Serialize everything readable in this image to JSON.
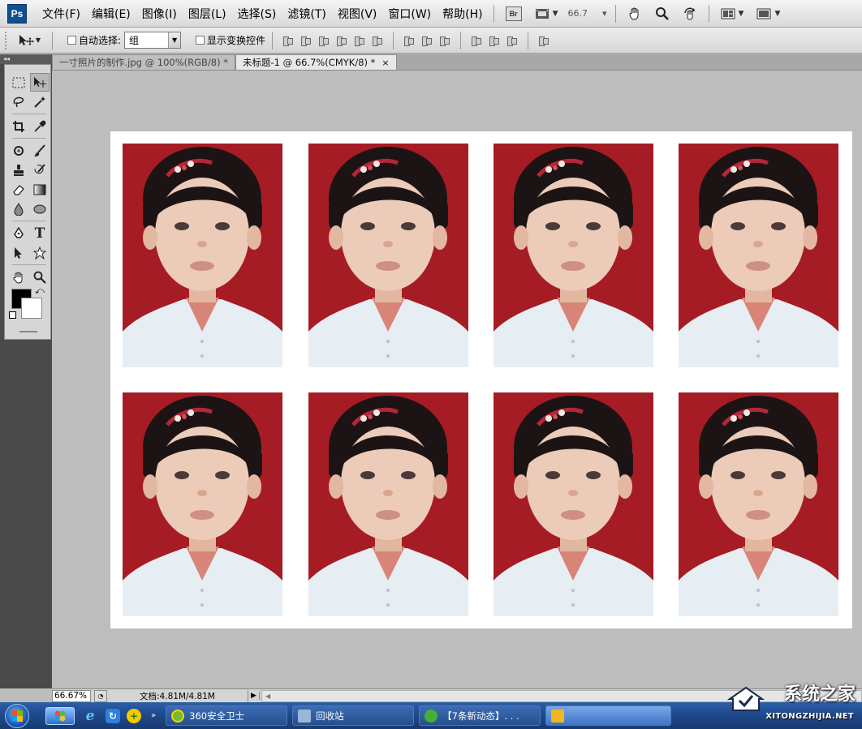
{
  "app": {
    "logo": "Ps"
  },
  "menubar": {
    "items": [
      "文件(F)",
      "编辑(E)",
      "图像(I)",
      "图层(L)",
      "选择(S)",
      "滤镜(T)",
      "视图(V)",
      "窗口(W)",
      "帮助(H)"
    ],
    "bridge_label": "Br",
    "zoom_value": "66.7",
    "zoom_arrow": "▾"
  },
  "options": {
    "auto_select_label": "自动选择:",
    "auto_select_value": "组",
    "show_transform_label": "显示变换控件"
  },
  "tabs": [
    {
      "label": "一寸照片的制作.jpg @ 100%(RGB/8) *",
      "close": "×"
    },
    {
      "label": "未标题-1 @ 66.7%(CMYK/8) *",
      "close": "×"
    }
  ],
  "document": {
    "photo_background": "#a61c24",
    "paper": "#ffffff",
    "photo_count": 8
  },
  "status": {
    "zoom": "66.67%",
    "doc_info": "文档:4.81M/4.81M",
    "arrow": "▶",
    "scroll_arrow": "◀"
  },
  "taskbar": {
    "tasks": [
      {
        "label": "360安全卫士",
        "color": "#6fbe2a"
      },
      {
        "label": "回收站",
        "color": "#9ab5d6"
      },
      {
        "label": "【7条新动态】. . .",
        "color": "#45b035"
      },
      {
        "label": "",
        "color": "#f2b71d"
      }
    ],
    "ql_more": "»"
  },
  "watermark": {
    "text": "系统之家",
    "sub": "XITONGZHIJIA.NET"
  },
  "toolbox": {
    "collapse": "◂◂",
    "type_tool_glyph": "T"
  }
}
